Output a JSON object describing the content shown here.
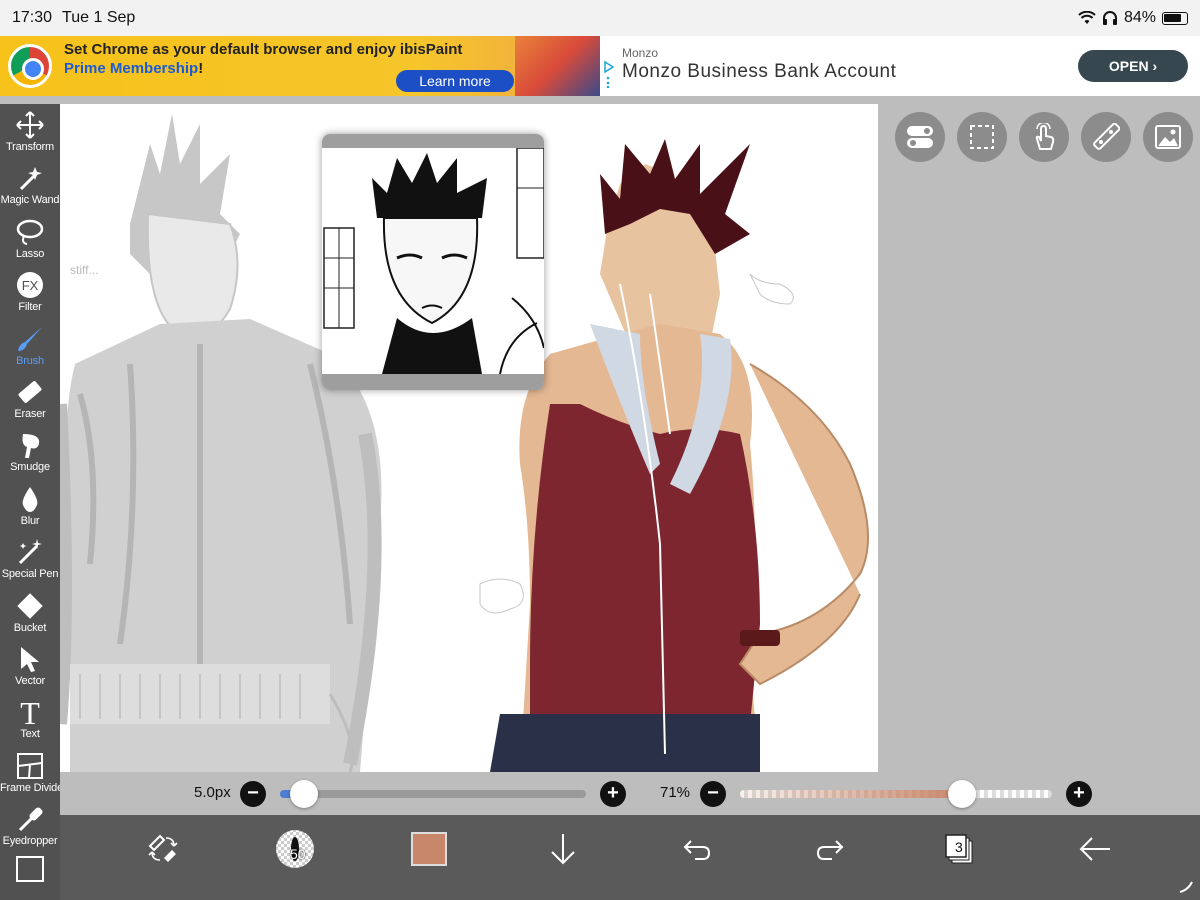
{
  "status": {
    "time": "17:30",
    "date": "Tue 1 Sep",
    "battery": "84%",
    "battery_level": 0.84
  },
  "ads": {
    "left": {
      "title_part1": "Set Chrome as your default browser and enjoy ibisPaint",
      "title_part2": "Prime Membership",
      "title_part3": "!",
      "button": "Learn more",
      "logo_icon": "chrome-logo-icon"
    },
    "right": {
      "brand": "Monzo",
      "headline": "Monzo Business Bank Account",
      "button": "OPEN"
    }
  },
  "toolbar": {
    "items": [
      {
        "label": "Transform",
        "icon": "move-arrows-icon"
      },
      {
        "label": "Magic Wand",
        "icon": "magic-wand-icon"
      },
      {
        "label": "Lasso",
        "icon": "lasso-icon"
      },
      {
        "label": "Filter",
        "icon": "fx-icon",
        "glyph": "FX"
      },
      {
        "label": "Brush",
        "icon": "brush-icon",
        "active": true
      },
      {
        "label": "Eraser",
        "icon": "eraser-icon"
      },
      {
        "label": "Smudge",
        "icon": "smudge-icon"
      },
      {
        "label": "Blur",
        "icon": "blur-drop-icon"
      },
      {
        "label": "Special Pen",
        "icon": "special-pen-icon"
      },
      {
        "label": "Bucket",
        "icon": "bucket-icon"
      },
      {
        "label": "Vector",
        "icon": "vector-cursor-icon"
      },
      {
        "label": "Text",
        "icon": "text-icon",
        "glyph": "T"
      },
      {
        "label": "Frame Divider",
        "icon": "frame-divider-icon"
      },
      {
        "label": "Eyedropper",
        "icon": "eyedropper-icon"
      }
    ]
  },
  "canvas": {
    "doodle_text": "stiff...",
    "top_tools": [
      "toggle-icon",
      "selection-icon",
      "gesture-icon",
      "ruler-icon",
      "reference-image-icon"
    ]
  },
  "sliders": {
    "size": {
      "value": "5.0px",
      "level": 0.08
    },
    "opacity": {
      "value": "71%",
      "level": 0.71
    }
  },
  "bottom_bar": {
    "layers_count": "3",
    "brush_preview_text": "50",
    "color_swatch": "#c8876a",
    "accent": "#4a7fd4"
  }
}
